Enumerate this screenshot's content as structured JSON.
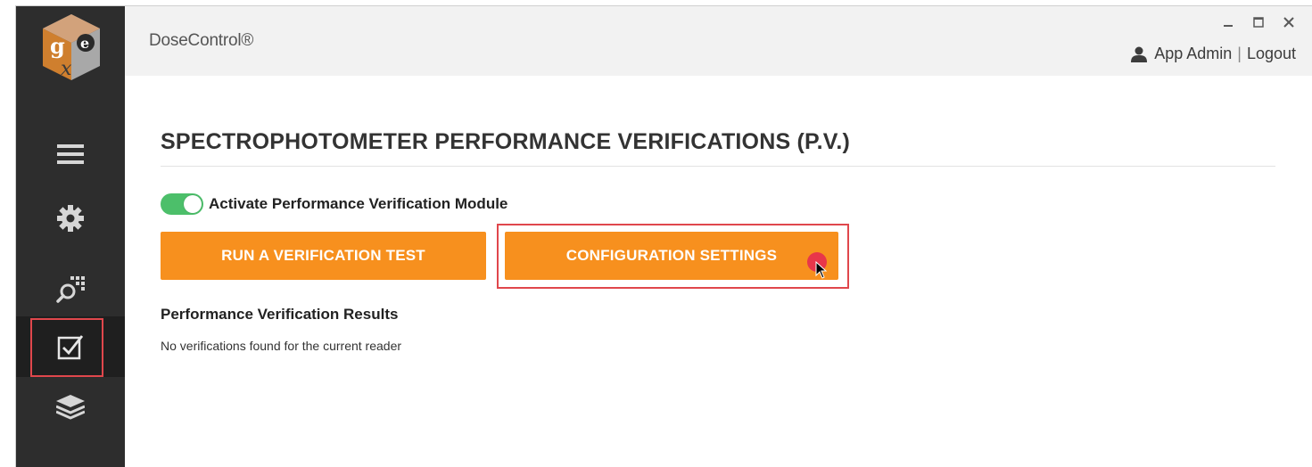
{
  "app": {
    "title": "DoseControl®"
  },
  "window_controls": {
    "minimize_icon": "minimize-icon",
    "maximize_icon": "maximize-icon",
    "close_icon": "close-icon"
  },
  "user": {
    "name": "App Admin",
    "separator": "|",
    "logout_label": "Logout"
  },
  "sidebar": {
    "items": [
      {
        "id": "menu",
        "icon": "hamburger-menu-icon",
        "active": false
      },
      {
        "id": "settings",
        "icon": "gear-icon",
        "active": false
      },
      {
        "id": "search",
        "icon": "search-grid-icon",
        "active": false
      },
      {
        "id": "verification",
        "icon": "checkbox-icon",
        "active": true
      },
      {
        "id": "layers",
        "icon": "layers-icon",
        "active": false
      }
    ]
  },
  "page": {
    "title": "SPECTROPHOTOMETER PERFORMANCE VERIFICATIONS (P.V.)",
    "toggle_label": "Activate Performance Verification Module",
    "toggle_on": true,
    "run_button_label": "RUN A VERIFICATION TEST",
    "config_button_label": "CONFIGURATION SETTINGS",
    "results_heading": "Performance Verification Results",
    "results_empty_text": "No verifications found for the current reader"
  },
  "colors": {
    "sidebar_bg": "#2d2d2d",
    "header_bg": "#f2f2f2",
    "accent_orange": "#f7901e",
    "toggle_green": "#4cbf6a",
    "highlight_red": "#e0474c"
  }
}
